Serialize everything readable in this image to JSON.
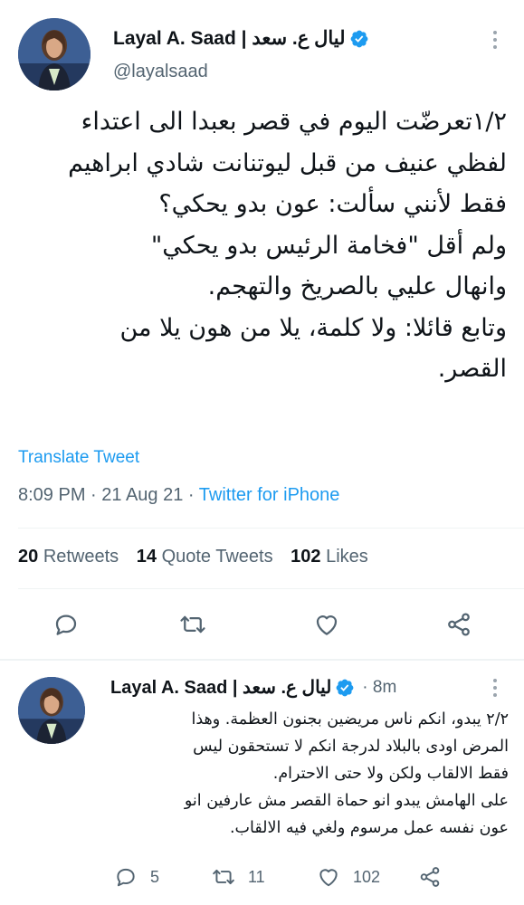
{
  "main_tweet": {
    "display_name": "Layal A. Saad | ليال ع. سعد",
    "handle": "@layalsaad",
    "text_lines": [
      "١/٢تعرضّت اليوم في قصر بعبدا الى اعتداء",
      "لفظي عنيف من قبل ليوتنانت شادي ابراهيم",
      "فقط لأنني سألت: عون بدو يحكي؟",
      "ولم أقل \"فخامة الرئيس بدو يحكي\"",
      "وانهال عليي بالصريخ والتهجم.",
      "وتابع قائلا: ولا كلمة، يلا من هون يلا من",
      "القصر."
    ],
    "translate_label": "Translate Tweet",
    "time": "8:09 PM",
    "date": "21 Aug 21",
    "source": "Twitter for iPhone",
    "stats": {
      "retweets_count": "20",
      "retweets_label": "Retweets",
      "quotes_count": "14",
      "quotes_label": "Quote Tweets",
      "likes_count": "102",
      "likes_label": "Likes"
    }
  },
  "reply_tweet": {
    "display_name": "Layal A. Saad | ليال ع. سعد",
    "time_ago": "8m",
    "text_lines": [
      "٢/٢ يبدو، انكم ناس مريضين بجنون العظمة. وهذا",
      "المرض اودى بالبلاد لدرجة انكم لا تستحقون ليس",
      "فقط الالقاب ولكن ولا حتى الاحترام.",
      "على الهامش يبدو انو حماة القصر مش عارفين انو",
      "عون نفسه عمل مرسوم ولغي فيه الالقاب."
    ],
    "reply_count": "5",
    "retweet_count": "11",
    "like_count": "102"
  },
  "icons": [
    "verified-badge-icon",
    "more-icon",
    "reply-icon",
    "retweet-icon",
    "like-icon",
    "share-icon"
  ],
  "colors": {
    "accent": "#1d9bf0",
    "text": "#0f1419",
    "secondary": "#536471",
    "divider": "#eff3f4"
  }
}
